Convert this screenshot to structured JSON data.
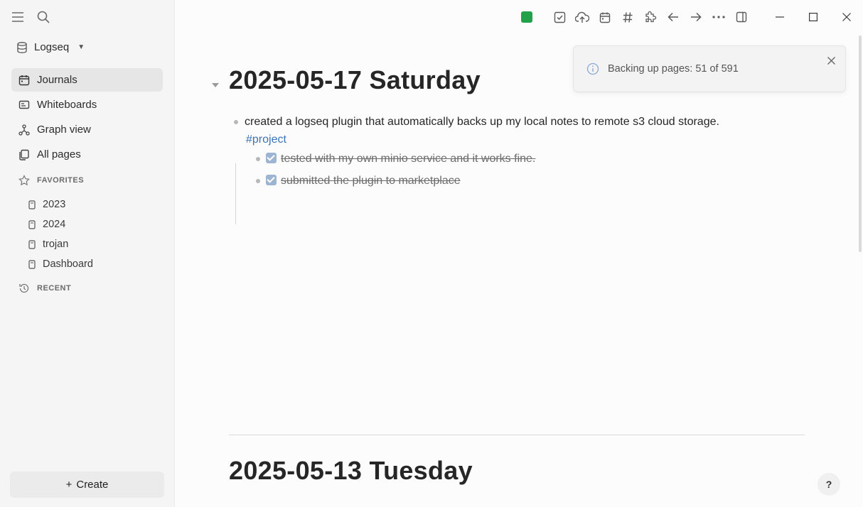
{
  "sidebar": {
    "graph_name": "Logseq",
    "nav": [
      {
        "label": "Journals",
        "icon": "calendar-icon",
        "active": true
      },
      {
        "label": "Whiteboards",
        "icon": "whiteboard-icon"
      },
      {
        "label": "Graph view",
        "icon": "graph-icon"
      },
      {
        "label": "All pages",
        "icon": "pages-icon"
      }
    ],
    "favorites_title": "FAVORITES",
    "favorites": [
      "2023",
      "2024",
      "trojan",
      "Dashboard"
    ],
    "recent_title": "RECENT",
    "create_label": "Create",
    "create_symbol": "+"
  },
  "toolbar": {
    "sync_color": "#22a04a",
    "icons": [
      "todo-icon",
      "cloud-upload-icon",
      "calendar-icon",
      "hash-icon",
      "puzzle-icon",
      "back-arrow-icon",
      "forward-arrow-icon",
      "more-icon",
      "right-sidebar-icon"
    ]
  },
  "journals": [
    {
      "title": "2025-05-17 Saturday",
      "blocks": {
        "main_text": "created a logseq plugin that automatically backs up my local notes to remote s3 cloud storage.",
        "tag": "#project",
        "children": [
          "tested with my own minio service and it works fine.",
          "submitted the plugin to marketplace"
        ]
      }
    },
    {
      "title": "2025-05-13 Tuesday"
    }
  ],
  "toast": {
    "message": "Backing up pages: 51 of 591"
  },
  "help_label": "?",
  "colors": {
    "accent_tag": "#3b73b5",
    "checkbox": "#9db5d3"
  }
}
